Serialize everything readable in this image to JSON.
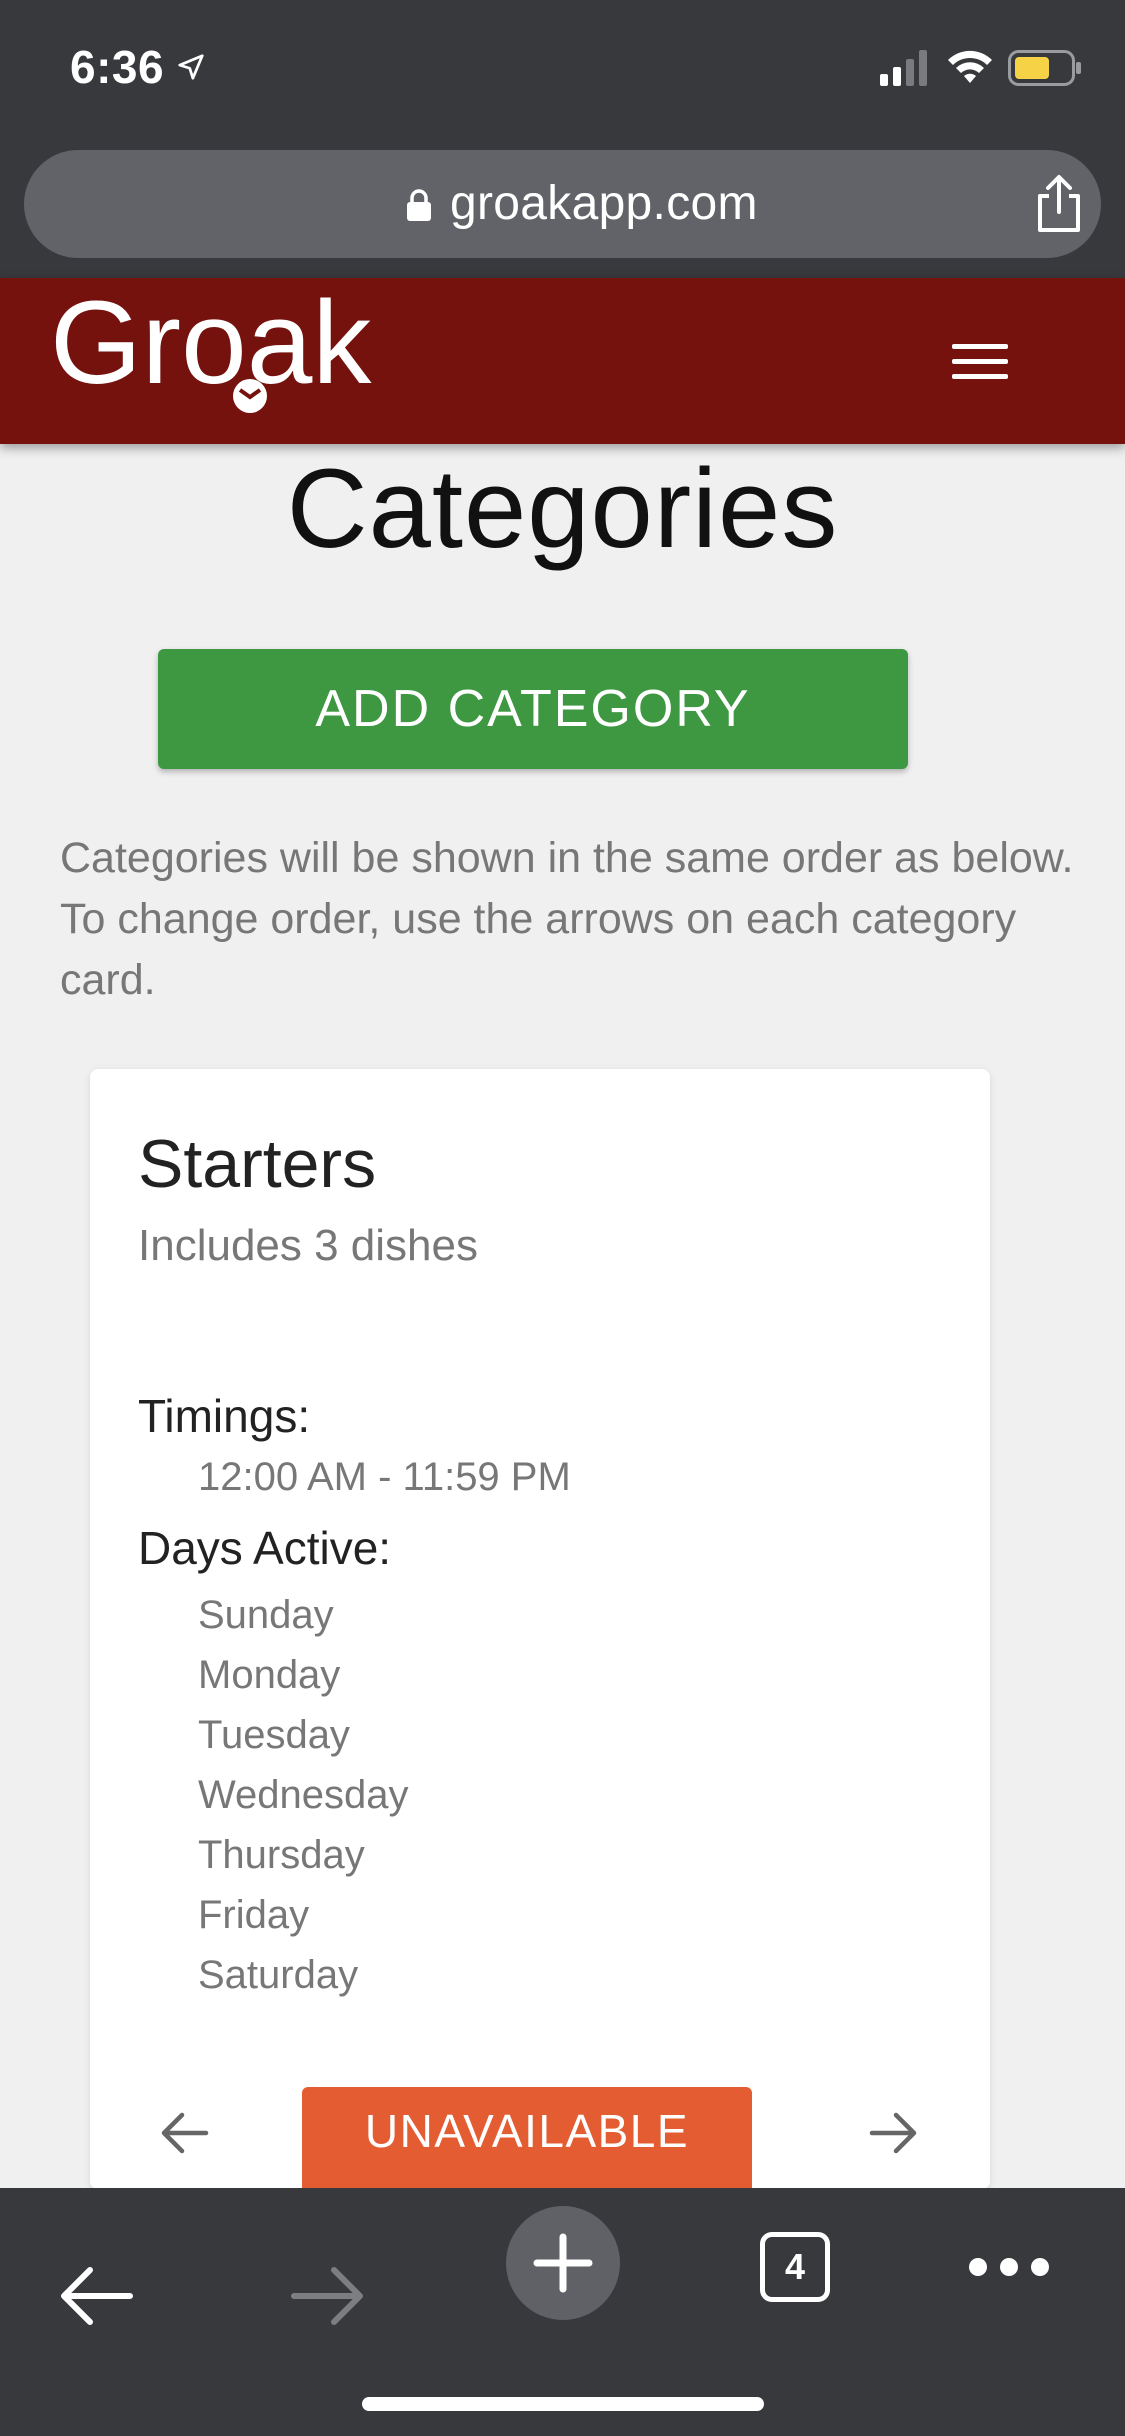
{
  "status_bar": {
    "time": "6:36",
    "location_icon": "location-arrow-icon",
    "signal_icon": "cellular-signal-icon",
    "wifi_icon": "wifi-icon",
    "battery_icon": "battery-icon"
  },
  "url_bar": {
    "domain": "groakapp.com",
    "lock_icon": "lock-icon",
    "share_icon": "share-icon"
  },
  "header": {
    "logo_text": "Groak",
    "menu_icon": "hamburger-menu-icon",
    "background_color": "#75120e"
  },
  "page": {
    "title": "Categories",
    "add_button_label": "ADD CATEGORY",
    "info_text": "Categories will be shown in the same order as below. To change order, use the arrows on each category card."
  },
  "category_card": {
    "name": "Starters",
    "subtitle": "Includes 3 dishes",
    "timings_label": "Timings:",
    "timings_value": "12:00 AM - 11:59 PM",
    "days_label": "Days Active:",
    "days": [
      "Sunday",
      "Monday",
      "Tuesday",
      "Wednesday",
      "Thursday",
      "Friday",
      "Saturday"
    ],
    "status_button_label": "UNAVAILABLE",
    "status_button_color": "#e35c32"
  },
  "toolbar": {
    "back_icon": "back-arrow-icon",
    "forward_icon": "forward-arrow-icon",
    "new_tab_icon": "plus-icon",
    "tab_count": "4",
    "more_icon": "more-dots-icon"
  },
  "colors": {
    "accent_green": "#3e9741",
    "browser_chrome": "#38393d"
  }
}
